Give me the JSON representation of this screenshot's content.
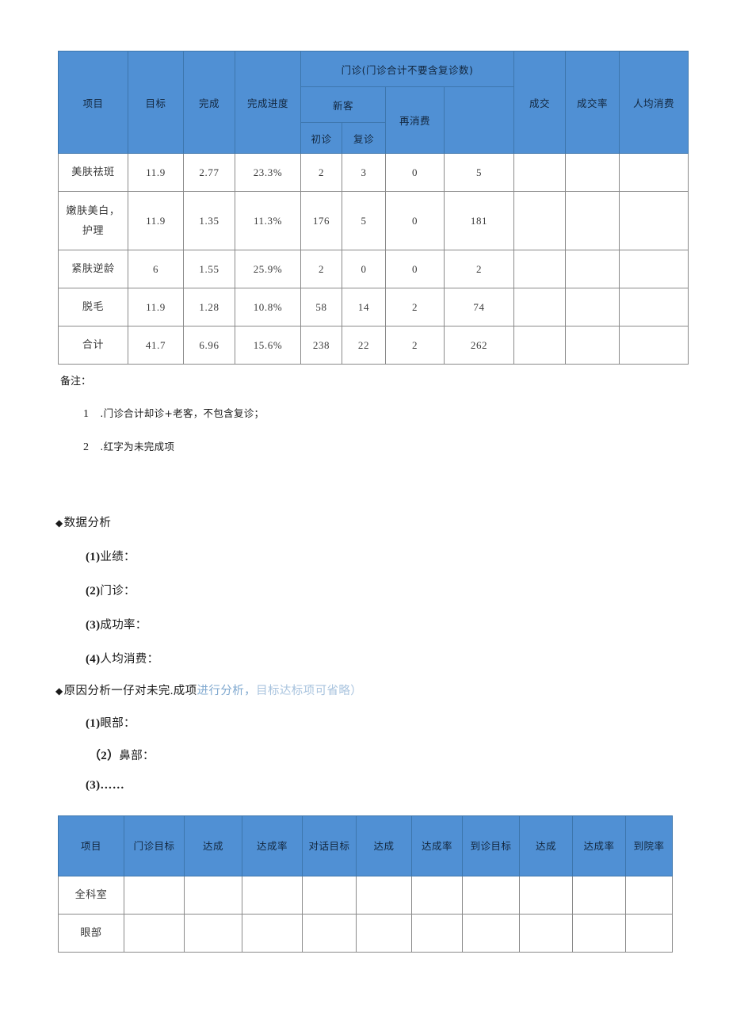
{
  "colors": {
    "header_blue": "#5090d4",
    "header_text": "#12263d",
    "grid_border": "#8a8a8a",
    "negative_red": "#f0a8ae",
    "accent_light_blue": "#7fa8cf",
    "accent_pale_blue": "#a8c3de"
  },
  "table1": {
    "header": {
      "col_project": "项目",
      "col_target": "目标",
      "col_complete": "完成",
      "col_progress": "完成进度",
      "group_outpatient": "门诊(门诊合计不要含复诊数)",
      "group_newcustomer": "新客",
      "col_first_visit": "初诊",
      "col_return_visit": "复诊",
      "col_repurchase": "再消费",
      "col_subtotal": "",
      "col_deal": "成交",
      "col_deal_rate": "成交率",
      "col_avg_spend": "人均消费"
    },
    "rows": [
      {
        "project": "美肤祛斑",
        "target": "11.9",
        "complete": "2.77",
        "progress": "23.3%",
        "progress_negative": false,
        "first_visit": "2",
        "return_visit": "3",
        "repurchase": "0",
        "subtotal": "5",
        "deal": "",
        "deal_rate": "",
        "avg_spend": ""
      },
      {
        "project": "嫩肤美白，护理",
        "project_line1": "嫩肤美白，",
        "project_line2": "护理",
        "target": "11.9",
        "complete": "1.35",
        "progress": "11.3%",
        "progress_negative": false,
        "first_visit": "176",
        "return_visit": "5",
        "repurchase": "0",
        "subtotal": "181",
        "deal": "",
        "deal_rate": "",
        "avg_spend": ""
      },
      {
        "project": "紧肤逆龄",
        "target": "6",
        "complete": "1.55",
        "progress": "25.9%",
        "progress_negative": false,
        "first_visit": "2",
        "return_visit": "0",
        "repurchase": "0",
        "subtotal": "2",
        "deal": "",
        "deal_rate": "",
        "avg_spend": ""
      },
      {
        "project": "脱毛",
        "target": "11.9",
        "complete": "1.28",
        "progress": "10.8%",
        "progress_negative": true,
        "first_visit": "58",
        "return_visit": "14",
        "repurchase": "2",
        "subtotal": "74",
        "deal": "",
        "deal_rate": "",
        "avg_spend": ""
      },
      {
        "project": "合计",
        "target": "41.7",
        "complete": "6.96",
        "progress": "15.6%",
        "progress_negative": false,
        "first_visit": "238",
        "return_visit": "22",
        "repurchase": "2",
        "subtotal": "262",
        "deal": "",
        "deal_rate": "",
        "avg_spend": ""
      }
    ]
  },
  "notes": {
    "title": "备注：",
    "items": [
      {
        "num": "1",
        "text": ".门诊合计却诊+老客，不包含复诊；"
      },
      {
        "num": "2",
        "text": ".红字为未完成项"
      }
    ]
  },
  "data_analysis": {
    "bullet": "◆",
    "heading": "数据分析",
    "items": [
      {
        "num": "(1)",
        "label": "业绩："
      },
      {
        "num": "(2)",
        "label": "门诊："
      },
      {
        "num": "(3)",
        "label": "成功率："
      },
      {
        "num": "(4)",
        "label": "人均消费："
      }
    ]
  },
  "cause_analysis": {
    "bullet": "◆",
    "heading_part1": "原因分析一仔对未完.成项",
    "heading_part2": "进行分析，",
    "heading_part3": "目标达标项可省略）",
    "items": [
      {
        "num": "(1)",
        "label": "眼部："
      },
      {
        "num": "（2）",
        "label": "鼻部："
      },
      {
        "num": "(3)",
        "label": "……"
      }
    ]
  },
  "table2": {
    "header": {
      "col_project": "项目",
      "col_outpatient_target": "门诊目标",
      "col_achieved_1": "达成",
      "col_achieve_rate_1": "达成率",
      "col_dialog_target": "对话目标",
      "col_achieved_2": "达成",
      "col_achieve_rate_2": "达成率",
      "col_visit_target": "到诊目标",
      "col_achieved_3": "达成",
      "col_achieve_rate_3": "达成率",
      "col_arrival_rate": "到院率"
    },
    "rows": [
      {
        "project": "全科室",
        "outpatient_target": "",
        "achieved_1": "",
        "achieve_rate_1": "",
        "dialog_target": "",
        "achieved_2": "",
        "achieve_rate_2": "",
        "visit_target": "",
        "achieved_3": "",
        "achieve_rate_3": "",
        "arrival_rate": ""
      },
      {
        "project": "眼部",
        "outpatient_target": "",
        "achieved_1": "",
        "achieve_rate_1": "",
        "dialog_target": "",
        "achieved_2": "",
        "achieve_rate_2": "",
        "visit_target": "",
        "achieved_3": "",
        "achieve_rate_3": "",
        "arrival_rate": ""
      }
    ]
  }
}
